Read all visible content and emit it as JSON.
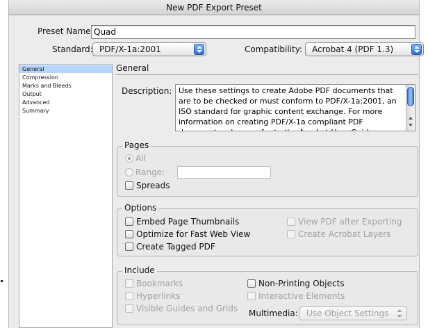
{
  "window": {
    "title": "New PDF Export Preset"
  },
  "preset": {
    "label": "Preset Name:",
    "value": "Quad"
  },
  "standard": {
    "label": "Standard:",
    "value": "PDF/X-1a:2001"
  },
  "compatibility": {
    "label": "Compatibility:",
    "value": "Acrobat 4 (PDF 1.3)"
  },
  "sidebar": {
    "items": [
      {
        "label": "General",
        "selected": true
      },
      {
        "label": "Compression"
      },
      {
        "label": "Marks and Bleeds"
      },
      {
        "label": "Output"
      },
      {
        "label": "Advanced"
      },
      {
        "label": "Summary"
      }
    ]
  },
  "general": {
    "title": "General",
    "description_label": "Description:",
    "description_text": "Use these settings to create Adobe PDF documents that are to be checked or must conform to PDF/X-1a:2001, an ISO standard for graphic content exchange.  For more information on creating PDF/X-1a compliant PDF documents, please refer to the Acrobat User Guide."
  },
  "pages": {
    "title": "Pages",
    "all_label": "All",
    "range_label": "Range:",
    "range_value": "",
    "spreads_label": "Spreads"
  },
  "options": {
    "title": "Options",
    "embed_thumbnails": "Embed Page Thumbnails",
    "optimize_web": "Optimize for Fast Web View",
    "tagged_pdf": "Create Tagged PDF",
    "view_after": "View PDF after Exporting",
    "acrobat_layers": "Create Acrobat Layers"
  },
  "include": {
    "title": "Include",
    "bookmarks": "Bookmarks",
    "hyperlinks": "Hyperlinks",
    "guides": "Visible Guides and Grids",
    "nonprinting": "Non-Printing Objects",
    "interactive": "Interactive Elements",
    "multimedia_label": "Multimedia:",
    "multimedia_value": "Use Object Settings"
  },
  "colors": {
    "accent": "#3b7ae0",
    "selection": "#b5d5ff",
    "window_bg": "#ececec"
  }
}
